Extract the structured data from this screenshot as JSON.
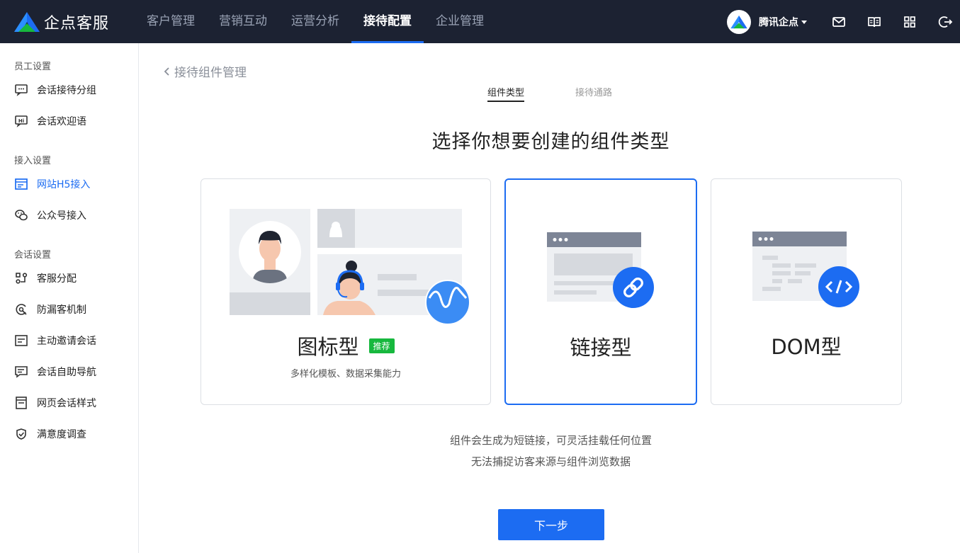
{
  "app": {
    "title": "企点客服",
    "brand_color": "#1c6cf2",
    "topbar_color": "#1c2232"
  },
  "nav": [
    {
      "label": "客户管理"
    },
    {
      "label": "营销互动"
    },
    {
      "label": "运营分析"
    },
    {
      "label": "接待配置",
      "active": true
    },
    {
      "label": "企业管理"
    }
  ],
  "account": {
    "name": "腾讯企点"
  },
  "toolbar_icons": [
    "mail-icon",
    "book-icon",
    "apps-grid-icon",
    "logout-icon"
  ],
  "sidebar": {
    "groups": [
      {
        "title": "员工设置",
        "items": [
          {
            "label": "会话接待分组",
            "icon": "chat-group-icon"
          },
          {
            "label": "会话欢迎语",
            "icon": "hi-icon"
          }
        ]
      },
      {
        "title": "接入设置",
        "items": [
          {
            "label": "网站H5接入",
            "icon": "web-h5-icon",
            "active": true
          },
          {
            "label": "公众号接入",
            "icon": "wechat-icon"
          }
        ]
      },
      {
        "title": "会话设置",
        "items": [
          {
            "label": "客服分配",
            "icon": "distribute-icon"
          },
          {
            "label": "防漏客机制",
            "icon": "anti-leak-icon"
          },
          {
            "label": "主动邀请会话",
            "icon": "invite-icon"
          },
          {
            "label": "会话自助导航",
            "icon": "self-nav-icon"
          },
          {
            "label": "网页会话样式",
            "icon": "web-style-icon"
          },
          {
            "label": "满意度调查",
            "icon": "survey-icon"
          }
        ]
      }
    ]
  },
  "page": {
    "back_label": "接待组件管理",
    "tabs": [
      {
        "label": "组件类型",
        "active": true
      },
      {
        "label": "接待通路"
      }
    ],
    "heading": "选择你想要创建的组件类型",
    "cards": [
      {
        "title": "图标型",
        "badge": "推荐",
        "subtitle": "多样化模板、数据采集能力"
      },
      {
        "title": "链接型",
        "selected": true,
        "icon": "link-icon"
      },
      {
        "title": "DOM型",
        "icon": "code-icon"
      }
    ],
    "description": [
      "组件会生成为短链接，可灵活挂载任何位置",
      "无法捕捉访客来源与组件浏览数据"
    ],
    "next_button": "下一步"
  }
}
